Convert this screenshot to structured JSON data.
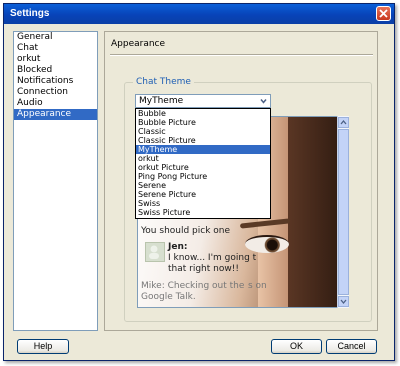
{
  "window": {
    "title": "Settings"
  },
  "sidebar": {
    "items": [
      {
        "label": "General"
      },
      {
        "label": "Chat"
      },
      {
        "label": "orkut"
      },
      {
        "label": "Blocked"
      },
      {
        "label": "Notifications"
      },
      {
        "label": "Connection"
      },
      {
        "label": "Audio"
      },
      {
        "label": "Appearance",
        "selected": true
      }
    ]
  },
  "panel": {
    "title": "Appearance",
    "group_label": "Chat Theme",
    "theme_select": {
      "value": "MyTheme",
      "options": [
        "Bubble",
        "Bubble Picture",
        "Classic",
        "Classic Picture",
        "MyTheme",
        "orkut",
        "orkut Picture",
        "Ping Pong Picture",
        "Serene",
        "Serene Picture",
        "Swiss",
        "Swiss Picture"
      ]
    },
    "preview": {
      "line1": "You should pick one",
      "sender": "Jen:",
      "msg_line1": "I know... I'm going t",
      "msg_line2": "that right now!!",
      "status_line1": "Mike: Checking out the",
      "status_line1_end": "s on",
      "status_line2": "Google Talk."
    }
  },
  "buttons": {
    "help": "Help",
    "ok": "OK",
    "cancel": "Cancel"
  },
  "colors": {
    "title_bar": "#0a4fc8",
    "selection": "#316ac5",
    "group_label": "#1f5fb4"
  }
}
